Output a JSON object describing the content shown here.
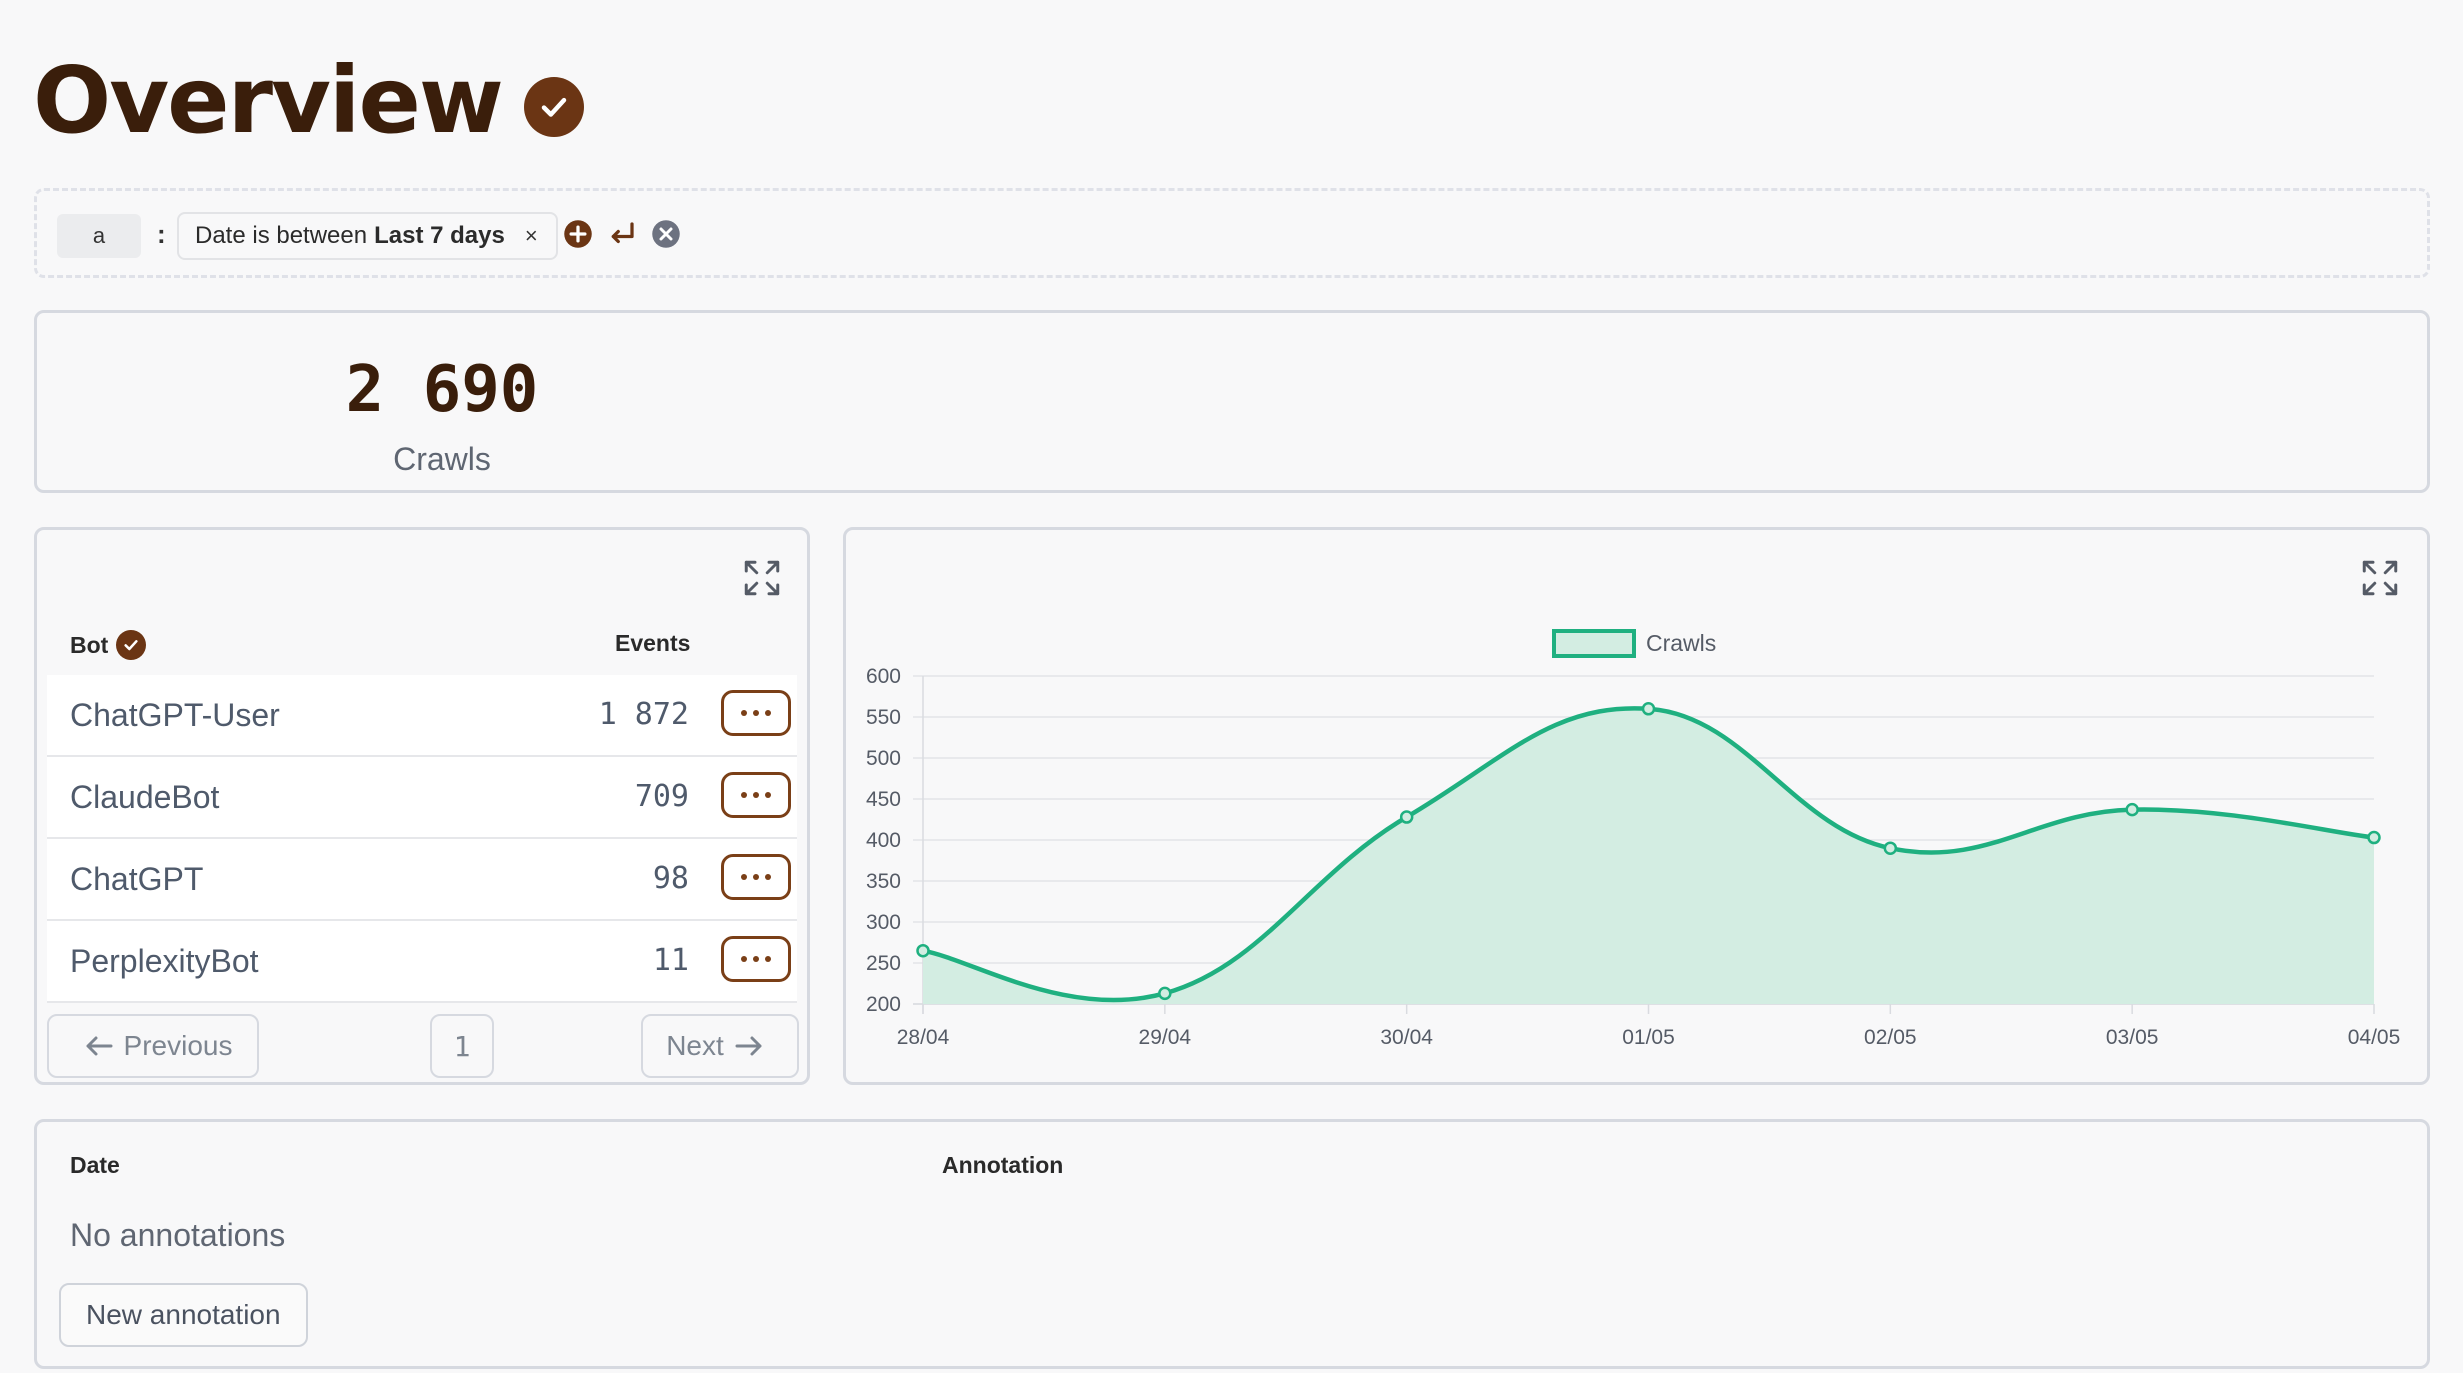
{
  "page": {
    "title": "Overview"
  },
  "filters": {
    "key": "a",
    "separator": ":",
    "chip_prefix": "Date is between",
    "chip_value": "Last 7 days",
    "chip_remove": "×"
  },
  "stat": {
    "value": "2 690",
    "label": "Crawls"
  },
  "bots_table": {
    "columns": {
      "bot": "Bot",
      "events": "Events"
    },
    "rows": [
      {
        "name": "ChatGPT-User",
        "events": "1 872"
      },
      {
        "name": "ClaudeBot",
        "events": "709"
      },
      {
        "name": "ChatGPT",
        "events": "98"
      },
      {
        "name": "PerplexityBot",
        "events": "11"
      }
    ],
    "pagination": {
      "previous": "Previous",
      "page": "1",
      "next": "Next"
    }
  },
  "chart_data": {
    "type": "line",
    "fill": true,
    "smooth": true,
    "categories": [
      "28/04",
      "29/04",
      "30/04",
      "01/05",
      "02/05",
      "03/05",
      "04/05"
    ],
    "series": [
      {
        "name": "Crawls",
        "values": [
          265,
          213,
          428,
          560,
          390,
          437,
          403
        ],
        "color": "#1fb080",
        "fill_color": "#d3ede2"
      }
    ],
    "ylim": [
      200,
      600
    ],
    "yticks": [
      200,
      250,
      300,
      350,
      400,
      450,
      500,
      550,
      600
    ],
    "grid": true,
    "legend": "top-center"
  },
  "annotations": {
    "columns": {
      "date": "Date",
      "annotation": "Annotation"
    },
    "empty": "No annotations",
    "new_button": "New annotation"
  },
  "colors": {
    "brand": "#6b3514",
    "accent": "#1fb080",
    "border": "#d6d9e0"
  },
  "icons": {
    "title_badge": "check-circle-icon",
    "filter_add": "plus-circle-icon",
    "filter_apply": "enter-icon",
    "filter_clear": "x-circle-icon",
    "expand": "expand-icon",
    "row_menu": "more-horizontal-icon",
    "prev": "arrow-left-icon",
    "next": "arrow-right-icon"
  }
}
